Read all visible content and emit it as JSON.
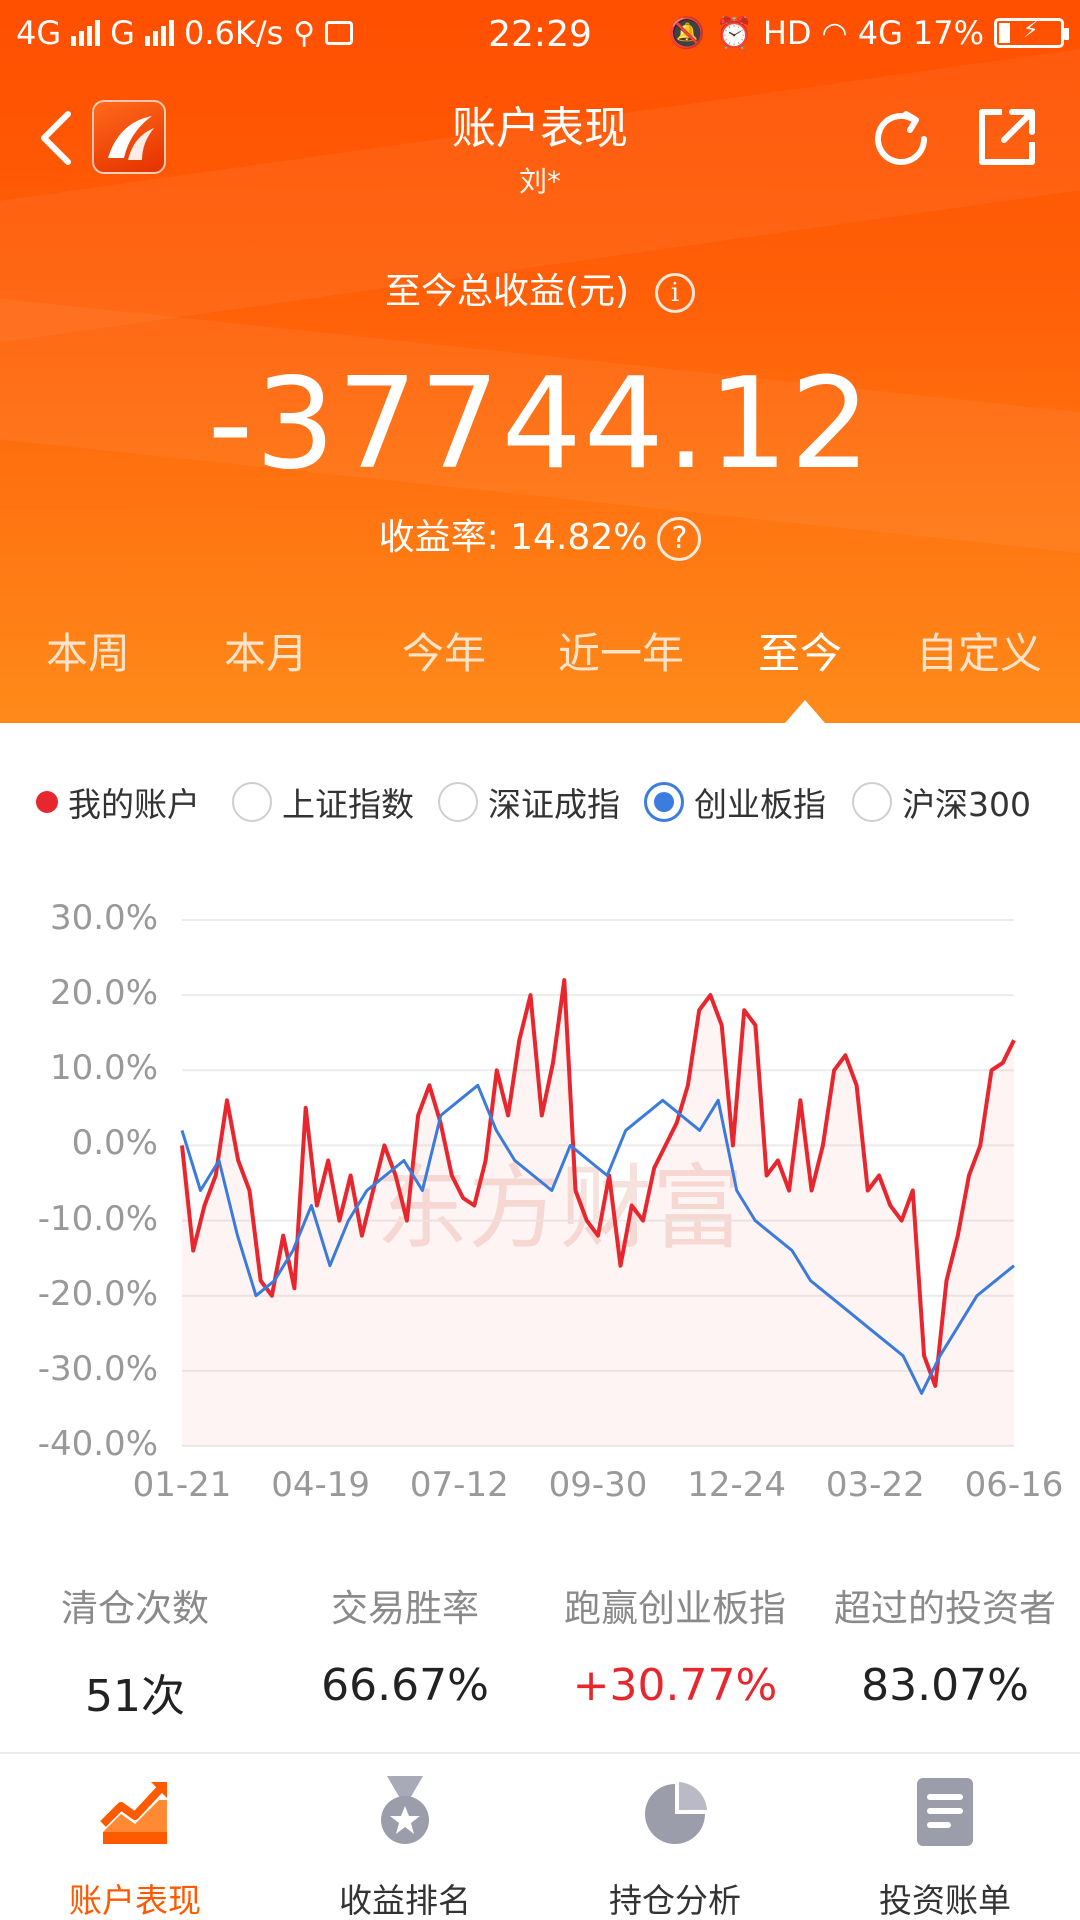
{
  "status_bar": {
    "net1": "4G",
    "net2": "G",
    "speed": "0.6K/s",
    "time": "22:29",
    "hd": "HD",
    "net3": "4G",
    "battery": "17%"
  },
  "nav": {
    "title": "账户表现",
    "subtitle": "刘*"
  },
  "summary": {
    "total_label": "至今总收益(元)",
    "total_value": "-37744.12",
    "rate_label": "收益率:",
    "rate_value": "14.82%"
  },
  "tabs": [
    "本周",
    "本月",
    "今年",
    "近一年",
    "至今",
    "自定义"
  ],
  "active_tab": "至今",
  "legend": {
    "my_account": "我的账户",
    "options": [
      "上证指数",
      "深证成指",
      "创业板指",
      "沪深300"
    ],
    "selected": "创业板指"
  },
  "chart_data": {
    "type": "line",
    "watermark": "东方财富",
    "y_ticks": [
      "30.0%",
      "20.0%",
      "10.0%",
      "0.0%",
      "-10.0%",
      "-20.0%",
      "-30.0%",
      "-40.0%"
    ],
    "x_ticks": [
      "01-21",
      "04-19",
      "07-12",
      "09-30",
      "12-24",
      "03-22",
      "06-16"
    ],
    "ylim": [
      -40,
      30
    ],
    "colors": {
      "account": "#e8262d",
      "index": "#3b7bdc"
    },
    "series": [
      {
        "name": "我的账户",
        "values": [
          0,
          -14,
          -8,
          -4,
          6,
          -2,
          -6,
          -18,
          -20,
          -12,
          -19,
          5,
          -8,
          -2,
          -10,
          -4,
          -12,
          -6,
          0,
          -4,
          -10,
          4,
          8,
          3,
          -4,
          -7,
          -8,
          -2,
          10,
          4,
          14,
          20,
          4,
          11,
          22,
          -6,
          -10,
          -12,
          -4,
          -16,
          -8,
          -10,
          -3,
          0,
          3,
          8,
          18,
          20,
          16,
          0,
          18,
          16,
          -4,
          -2,
          -6,
          6,
          -6,
          0,
          10,
          12,
          8,
          -6,
          -4,
          -8,
          -10,
          -6,
          -28,
          -32,
          -18,
          -12,
          -4,
          0,
          10,
          11,
          14
        ]
      },
      {
        "name": "创业板指",
        "values": [
          2,
          -6,
          -2,
          -12,
          -20,
          -18,
          -14,
          -8,
          -16,
          -10,
          -6,
          -4,
          -2,
          -6,
          4,
          6,
          8,
          2,
          -2,
          -4,
          -6,
          0,
          -2,
          -4,
          2,
          4,
          6,
          4,
          2,
          6,
          -6,
          -10,
          -12,
          -14,
          -18,
          -20,
          -22,
          -24,
          -26,
          -28,
          -33,
          -28,
          -24,
          -20,
          -18,
          -16
        ]
      }
    ]
  },
  "stats": [
    {
      "label": "清仓次数",
      "value": "51次"
    },
    {
      "label": "交易胜率",
      "value": "66.67%"
    },
    {
      "label": "跑赢创业板指",
      "value": "+30.77%",
      "highlight": true
    },
    {
      "label": "超过的投资者",
      "value": "83.07%"
    }
  ],
  "bottom_nav": [
    {
      "label": "账户表现",
      "icon": "trend-chart-icon",
      "active": true
    },
    {
      "label": "收益排名",
      "icon": "medal-icon",
      "active": false
    },
    {
      "label": "持仓分析",
      "icon": "pie-chart-icon",
      "active": false
    },
    {
      "label": "投资账单",
      "icon": "document-list-icon",
      "active": false
    }
  ]
}
